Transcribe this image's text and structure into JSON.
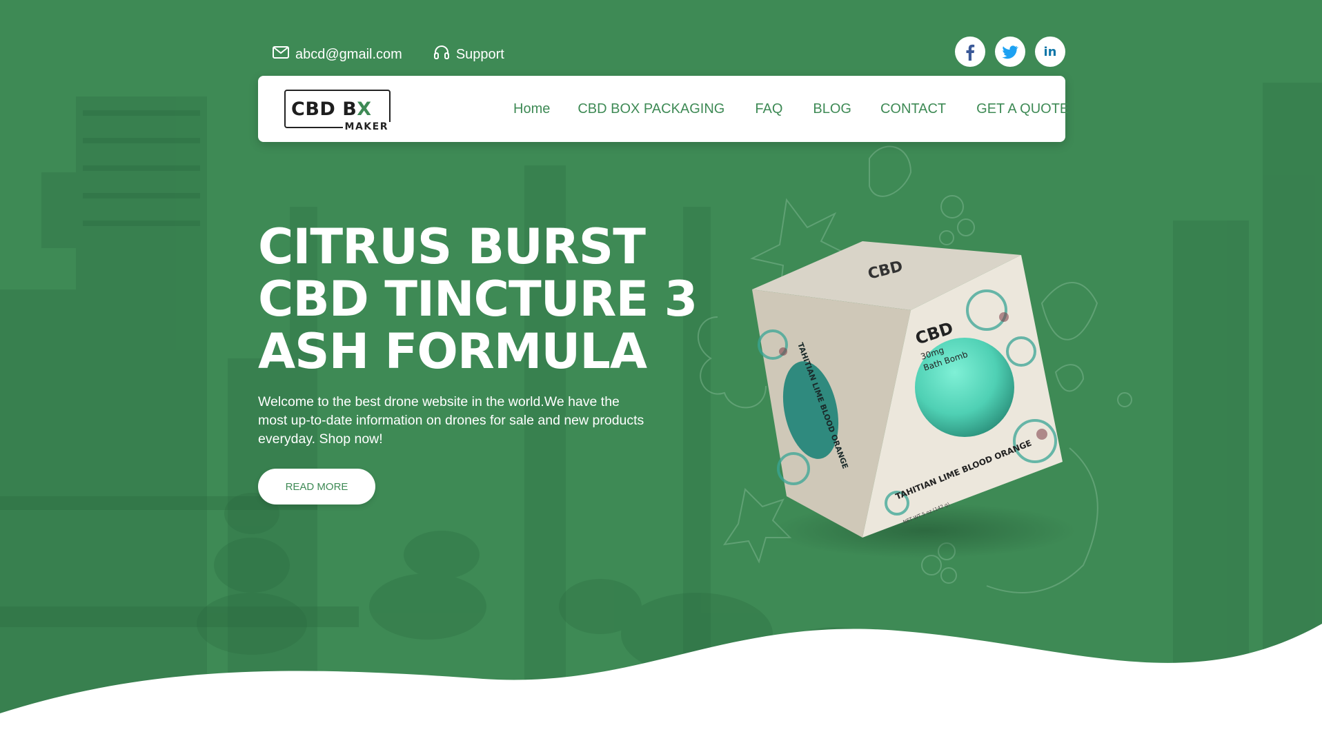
{
  "colors": {
    "brand_green": "#3e8a55",
    "white": "#ffffff",
    "facebook": "#3b5998",
    "twitter": "#1da1f2",
    "linkedin": "#0e76a8"
  },
  "topbar": {
    "email": "abcd@gmail.com",
    "support": "Support",
    "email_icon": "envelope-icon",
    "support_icon": "headset-icon"
  },
  "socials": [
    {
      "name": "facebook",
      "icon": "facebook-icon",
      "glyph": "f"
    },
    {
      "name": "twitter",
      "icon": "twitter-icon"
    },
    {
      "name": "linkedin",
      "icon": "linkedin-icon",
      "glyph": "in"
    }
  ],
  "logo": {
    "line1_a": "CBD B",
    "line1_b": "X",
    "line2": "MAKER"
  },
  "nav": {
    "items": [
      {
        "label": "Home"
      },
      {
        "label": "CBD BOX PACKAGING"
      },
      {
        "label": "FAQ"
      },
      {
        "label": "BLOG"
      },
      {
        "label": "CONTACT"
      },
      {
        "label": "GET A QUOTE"
      }
    ]
  },
  "hero": {
    "title": "CITRUS BURST CBD TINCTURE 3 ASH FORMULA",
    "description": "Welcome to the best drone website in the world.We have the most up-to-date information on drones for sale and new products everyday. Shop now!",
    "button": "READ MORE"
  },
  "product": {
    "box_brand": "CBD",
    "box_strength": "30mg",
    "box_type": "Bath Bomb",
    "box_flavor_front": "TAHITIAN LIME BLOOD ORANGE",
    "box_flavor_side": "TAHITIAN LIME BLOOD ORANGE",
    "box_weight": "NET WT 5 oz (142 g)",
    "box_lid": "CBD"
  }
}
